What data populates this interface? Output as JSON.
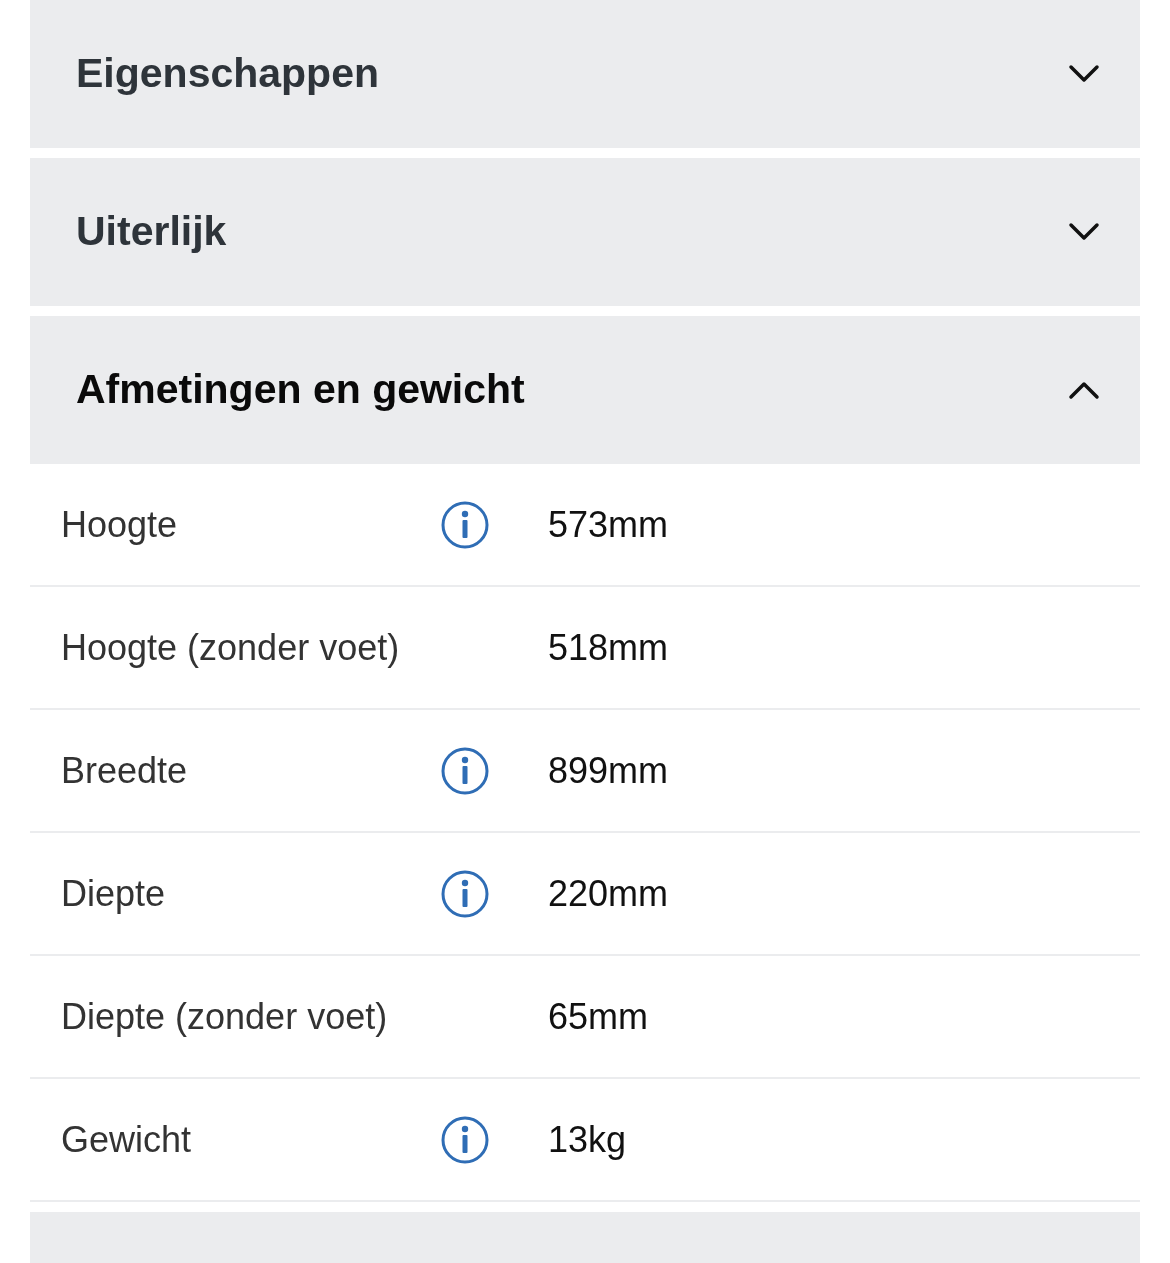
{
  "sections": [
    {
      "title": "Eigenschappen",
      "expanded": false
    },
    {
      "title": "Uiterlijk",
      "expanded": false
    },
    {
      "title": "Afmetingen en gewicht",
      "expanded": true,
      "rows": [
        {
          "label": "Hoogte",
          "info": true,
          "value": "573mm"
        },
        {
          "label": "Hoogte (zonder voet)",
          "info": false,
          "value": "518mm"
        },
        {
          "label": "Breedte",
          "info": true,
          "value": "899mm"
        },
        {
          "label": "Diepte",
          "info": true,
          "value": "220mm"
        },
        {
          "label": "Diepte (zonder voet)",
          "info": false,
          "value": "65mm"
        },
        {
          "label": "Gewicht",
          "info": true,
          "value": "13kg"
        }
      ]
    },
    {
      "expanded": false
    }
  ]
}
